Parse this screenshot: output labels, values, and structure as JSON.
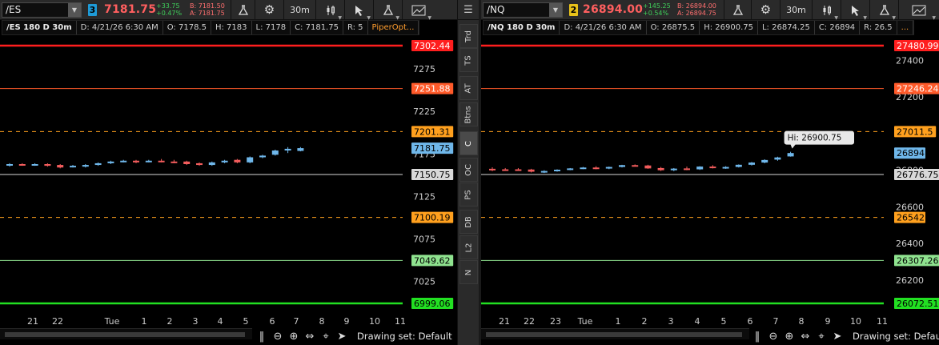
{
  "left": {
    "symbol": "/ES",
    "link_number": "3",
    "link_color": "#1e9bd7",
    "last": "7181.75",
    "change": "+33.75",
    "change_pct": "+0.47%",
    "bid": "B: 7181.50",
    "ask": "A: 7181.75",
    "timeframe": "30m",
    "info": {
      "study": "/ES 180 D 30m",
      "date": "D: 4/21/26 6:30 AM",
      "open": "O: 7178.5",
      "high": "H: 7183",
      "low": "L: 7178",
      "close": "C: 7181.75",
      "range": "R: 5",
      "study_name": "PiperOpt..."
    },
    "yticks": [
      "7300",
      "7275",
      "7250",
      "7225",
      "7200",
      "7175",
      "7150",
      "7125",
      "7100",
      "7075",
      "7050",
      "7025",
      "7000"
    ],
    "xticks": [
      "21",
      "22",
      "Tue",
      "1",
      "2",
      "3",
      "4",
      "5",
      "6",
      "7",
      "8",
      "9",
      "10",
      "11"
    ],
    "levels": [
      {
        "label": "7302.44",
        "color": "#ff1e1e",
        "text": "#ffffff",
        "style": "solid",
        "w": 2.5
      },
      {
        "label": "7251.88",
        "color": "#ff5a2a",
        "text": "#ffffff",
        "style": "solid",
        "w": 1
      },
      {
        "label": "7201.31",
        "color": "#ffa01e",
        "text": "#000000",
        "style": "dash",
        "w": 1
      },
      {
        "label": "7181.75",
        "color": "#6fb7ea",
        "text": "#000000",
        "style": "none",
        "w": 1
      },
      {
        "label": "7150.75",
        "color": "#d8d8d8",
        "text": "#000000",
        "style": "solid",
        "w": 1
      },
      {
        "label": "7100.19",
        "color": "#ffa01e",
        "text": "#000000",
        "style": "dash",
        "w": 1
      },
      {
        "label": "7049.62",
        "color": "#8fe38f",
        "text": "#000000",
        "style": "solid",
        "w": 1
      },
      {
        "label": "6999.06",
        "color": "#22e022",
        "text": "#000000",
        "style": "solid",
        "w": 2.5
      }
    ],
    "candles": [
      [
        7162,
        7164,
        7160,
        7163
      ],
      [
        7163,
        7164,
        7161,
        7162
      ],
      [
        7162,
        7164,
        7161,
        7163
      ],
      [
        7163,
        7164,
        7160,
        7161
      ],
      [
        7162,
        7163,
        7158,
        7159
      ],
      [
        7160,
        7162,
        7159,
        7161
      ],
      [
        7160,
        7163,
        7159,
        7162
      ],
      [
        7162,
        7165,
        7161,
        7164
      ],
      [
        7164,
        7167,
        7163,
        7166
      ],
      [
        7166,
        7168,
        7165,
        7167
      ],
      [
        7167,
        7168,
        7164,
        7165
      ],
      [
        7166,
        7168,
        7165,
        7167
      ],
      [
        7167,
        7169,
        7165,
        7166
      ],
      [
        7166,
        7168,
        7164,
        7165
      ],
      [
        7166,
        7167,
        7162,
        7163
      ],
      [
        7164,
        7165,
        7161,
        7162
      ],
      [
        7162,
        7166,
        7161,
        7165
      ],
      [
        7165,
        7168,
        7164,
        7167
      ],
      [
        7168,
        7169,
        7164,
        7165
      ],
      [
        7165,
        7172,
        7164,
        7171
      ],
      [
        7171,
        7174,
        7170,
        7173
      ],
      [
        7174,
        7180,
        7173,
        7179
      ],
      [
        7179,
        7183,
        7176,
        7181
      ],
      [
        7178.5,
        7183,
        7178,
        7181.75
      ]
    ]
  },
  "right": {
    "symbol": "/NQ",
    "link_number": "2",
    "link_color": "#e8c21a",
    "last": "26894.00",
    "change": "+145.25",
    "change_pct": "+0.54%",
    "bid": "B: 26894.00",
    "ask": "A: 26894.75",
    "timeframe": "30m",
    "info": {
      "study": "/NQ 180 D 30m",
      "date": "D: 4/21/26 6:30 AM",
      "open": "O: 26875.5",
      "high": "H: 26900.75",
      "low": "L: 26874.25",
      "close": "C: 26894",
      "range": "R: 26.5",
      "more": "..."
    },
    "hi_callout": "Hi: 26900.75",
    "yticks": [
      "27400",
      "27200",
      "27000",
      "26800",
      "26600",
      "26400",
      "26200"
    ],
    "xticks": [
      "21",
      "22",
      "23",
      "Tue",
      "1",
      "2",
      "3",
      "4",
      "5",
      "6",
      "7",
      "8",
      "9",
      "10",
      "11"
    ],
    "levels": [
      {
        "label": "27480.99",
        "color": "#ff1e1e",
        "text": "#ffffff",
        "style": "solid",
        "w": 2.5
      },
      {
        "label": "27246.24",
        "color": "#ff5a2a",
        "text": "#ffffff",
        "style": "solid",
        "w": 1
      },
      {
        "label": "27011.5",
        "color": "#ffa01e",
        "text": "#000000",
        "style": "dash",
        "w": 1
      },
      {
        "label": "26894",
        "color": "#6fb7ea",
        "text": "#000000",
        "style": "none",
        "w": 1
      },
      {
        "label": "26776.75",
        "color": "#d8d8d8",
        "text": "#000000",
        "style": "solid",
        "w": 1
      },
      {
        "label": "26542",
        "color": "#ffa01e",
        "text": "#000000",
        "style": "dash",
        "w": 1
      },
      {
        "label": "26307.26",
        "color": "#8fe38f",
        "text": "#000000",
        "style": "solid",
        "w": 1
      },
      {
        "label": "26072.51",
        "color": "#22e022",
        "text": "#000000",
        "style": "solid",
        "w": 2.5
      }
    ],
    "candles": [
      [
        26808,
        26816,
        26795,
        26800
      ],
      [
        26805,
        26812,
        26798,
        26802
      ],
      [
        26805,
        26812,
        26798,
        26804
      ],
      [
        26804,
        26808,
        26788,
        26792
      ],
      [
        26792,
        26800,
        26785,
        26796
      ],
      [
        26796,
        26805,
        26792,
        26803
      ],
      [
        26803,
        26812,
        26800,
        26810
      ],
      [
        26810,
        26818,
        26806,
        26815
      ],
      [
        26815,
        26822,
        26805,
        26808
      ],
      [
        26810,
        26820,
        26806,
        26818
      ],
      [
        26818,
        26830,
        26815,
        26828
      ],
      [
        26828,
        26832,
        26823,
        26826
      ],
      [
        26826,
        26830,
        26808,
        26810
      ],
      [
        26812,
        26818,
        26796,
        26800
      ],
      [
        26800,
        26812,
        26795,
        26809
      ],
      [
        26810,
        26820,
        26800,
        26804
      ],
      [
        26805,
        26822,
        26802,
        26820
      ],
      [
        26820,
        26828,
        26810,
        26815
      ],
      [
        26812,
        26822,
        26808,
        26818
      ],
      [
        26818,
        26832,
        26815,
        26830
      ],
      [
        26830,
        26845,
        26826,
        26842
      ],
      [
        26842,
        26860,
        26838,
        26856
      ],
      [
        26858,
        26874,
        26852,
        26870
      ],
      [
        26875.5,
        26900.75,
        26874.25,
        26894
      ]
    ]
  },
  "drawing_set": "Drawing set: Default",
  "sidetabs": [
    "Trd",
    "TS",
    "AT",
    "Btns",
    "C",
    "OC",
    "PS",
    "DB",
    "L2",
    "N"
  ],
  "sidetab_active": "C",
  "colors": {
    "up": "#6fb7ea",
    "down": "#f25c5c",
    "bg": "#000000"
  }
}
